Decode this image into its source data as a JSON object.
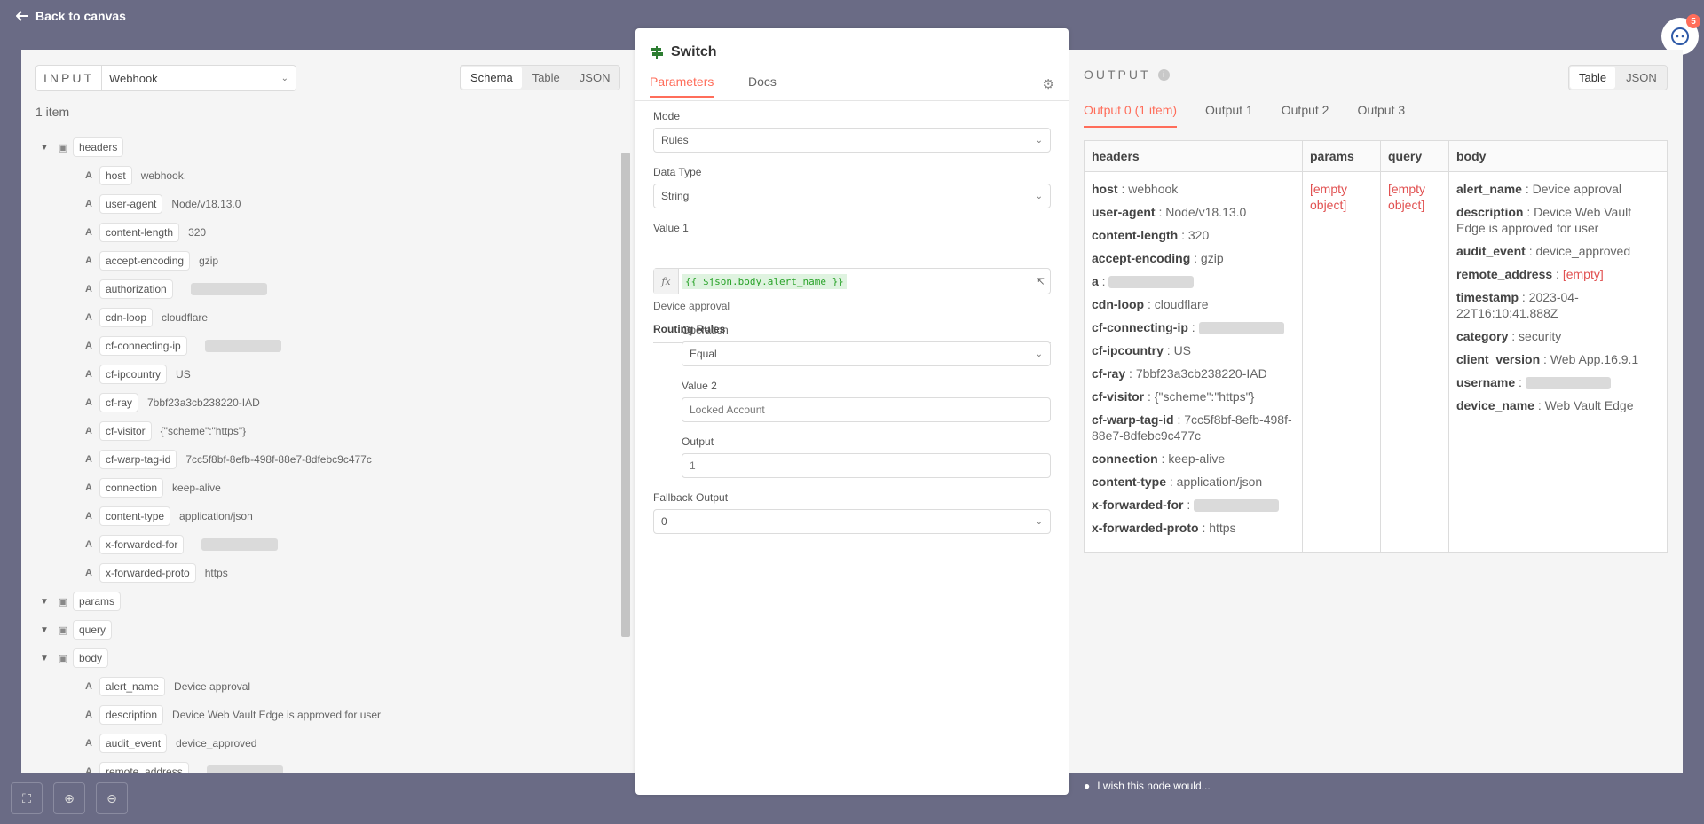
{
  "back_label": "Back to canvas",
  "chat_badge": "5",
  "input": {
    "label": "INPUT",
    "node": "Webhook",
    "views": [
      "Schema",
      "Table",
      "JSON"
    ],
    "active_view": "Schema",
    "item_count": "1 item",
    "headers_key": "headers",
    "headers": [
      {
        "key": "host",
        "value": "webhook."
      },
      {
        "key": "user-agent",
        "value": "Node/v18.13.0"
      },
      {
        "key": "content-length",
        "value": "320"
      },
      {
        "key": "accept-encoding",
        "value": "gzip"
      },
      {
        "key": "authorization",
        "value": ""
      },
      {
        "key": "cdn-loop",
        "value": "cloudflare"
      },
      {
        "key": "cf-connecting-ip",
        "value": ""
      },
      {
        "key": "cf-ipcountry",
        "value": "US"
      },
      {
        "key": "cf-ray",
        "value": "7bbf23a3cb238220-IAD"
      },
      {
        "key": "cf-visitor",
        "value": "{\"scheme\":\"https\"}"
      },
      {
        "key": "cf-warp-tag-id",
        "value": "7cc5f8bf-8efb-498f-88e7-8dfebc9c477c"
      },
      {
        "key": "connection",
        "value": "keep-alive"
      },
      {
        "key": "content-type",
        "value": "application/json"
      },
      {
        "key": "x-forwarded-for",
        "value": ""
      },
      {
        "key": "x-forwarded-proto",
        "value": "https"
      }
    ],
    "params_key": "params",
    "query_key": "query",
    "body_key": "body",
    "body": [
      {
        "key": "alert_name",
        "value": "Device approval"
      },
      {
        "key": "description",
        "value": "Device Web Vault Edge is approved for user"
      },
      {
        "key": "audit_event",
        "value": "device_approved"
      },
      {
        "key": "remote_address",
        "value": ""
      }
    ]
  },
  "switch": {
    "title": "Switch",
    "tabs": [
      "Parameters",
      "Docs"
    ],
    "mode_label": "Mode",
    "mode_value": "Rules",
    "data_type_label": "Data Type",
    "data_type_value": "String",
    "value1_label": "Value 1",
    "value1_expr": "{{ $json.body.alert_name }}",
    "value1_result": "Device approval",
    "routing_rules_label": "Routing Rules",
    "operation_label": "Operation",
    "operation_value": "Equal",
    "value2_label": "Value 2",
    "value2_placeholder": "Locked Account",
    "output_label": "Output",
    "output_value": "1",
    "fallback_label": "Fallback Output",
    "fallback_value": "0"
  },
  "output": {
    "label": "OUTPUT",
    "views": [
      "Table",
      "JSON"
    ],
    "active_view": "Table",
    "tabs": [
      "Output 0 (1 item)",
      "Output 1",
      "Output 2",
      "Output 3"
    ],
    "columns": [
      "headers",
      "params",
      "query",
      "body"
    ],
    "headers": [
      {
        "key": "host",
        "value": "webhook"
      },
      {
        "key": "user-agent",
        "value": "Node/v18.13.0"
      },
      {
        "key": "content-length",
        "value": "320"
      },
      {
        "key": "accept-encoding",
        "value": "gzip"
      },
      {
        "key": "a",
        "value": ""
      },
      {
        "key": "cdn-loop",
        "value": "cloudflare"
      },
      {
        "key": "cf-connecting-ip",
        "value": ""
      },
      {
        "key": "cf-ipcountry",
        "value": "US"
      },
      {
        "key": "cf-ray",
        "value": "7bbf23a3cb238220-IAD"
      },
      {
        "key": "cf-visitor",
        "value": "{\"scheme\":\"https\"}"
      },
      {
        "key": "cf-warp-tag-id",
        "value": "7cc5f8bf-8efb-498f-88e7-8dfebc9c477c"
      },
      {
        "key": "connection",
        "value": "keep-alive"
      },
      {
        "key": "content-type",
        "value": "application/json"
      },
      {
        "key": "x-forwarded-for",
        "value": ""
      },
      {
        "key": "x-forwarded-proto",
        "value": "https"
      }
    ],
    "params_value": "[empty object]",
    "query_value": "[empty object]",
    "body": [
      {
        "key": "alert_name",
        "value": "Device approval"
      },
      {
        "key": "description",
        "value": "Device Web Vault Edge is approved for user"
      },
      {
        "key": "audit_event",
        "value": "device_approved"
      },
      {
        "key": "remote_address",
        "value": "[empty]"
      },
      {
        "key": "timestamp",
        "value": "2023-04-22T16:10:41.888Z"
      },
      {
        "key": "category",
        "value": "security"
      },
      {
        "key": "client_version",
        "value": "Web App.16.9.1"
      },
      {
        "key": "username",
        "value": ""
      },
      {
        "key": "device_name",
        "value": "Web Vault Edge"
      }
    ]
  },
  "hint": "I wish this node would..."
}
